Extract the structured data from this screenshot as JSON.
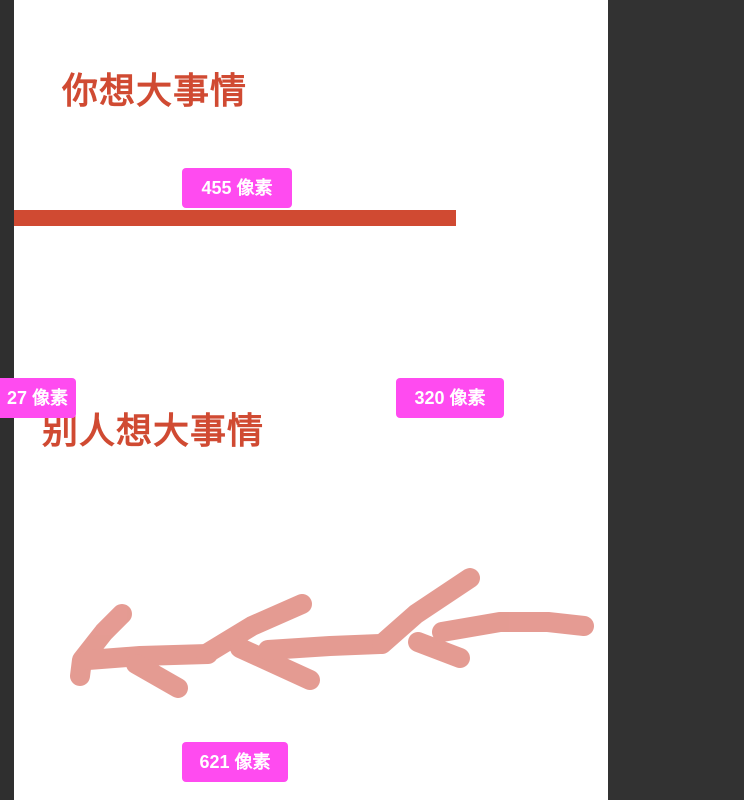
{
  "canvas": {
    "headline_top": "你想大事情",
    "headline_bottom": "别人想大事情"
  },
  "measurements": {
    "bar_width": "455 像素",
    "left_offset": "27 像素",
    "right_offset": "320 像素",
    "bottom_width": "621 像素"
  },
  "colors": {
    "background": "#2f2f2f",
    "canvas": "#ffffff",
    "accent_red": "#d04a32",
    "measure_badge": "#ff4bf0",
    "scribble": "#e08a80"
  }
}
